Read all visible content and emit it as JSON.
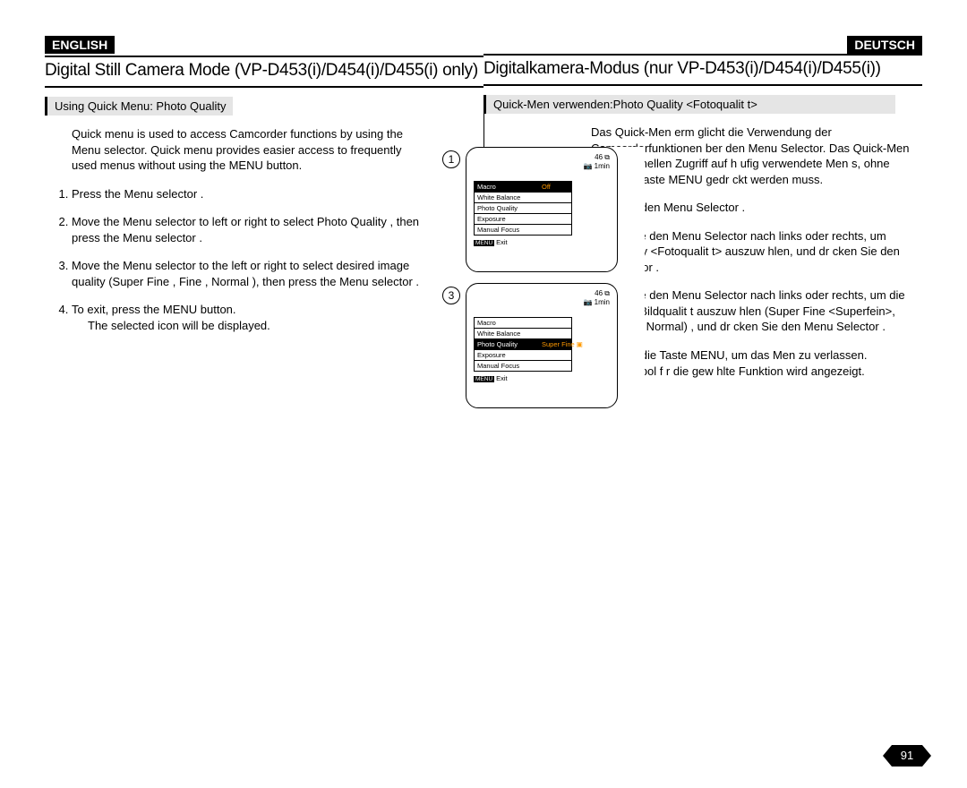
{
  "left": {
    "lang": "ENGLISH",
    "title": "Digital Still Camera Mode (VP-D453(i)/D454(i)/D455(i) only)",
    "subhead": "Using Quick Menu: Photo Quality",
    "intro": "Quick menu is used to access Camcorder functions by using the Menu selector. Quick menu provides easier access to frequently used menus without using the MENU button.",
    "steps": [
      "Press the Menu selector .",
      "Move the Menu selector  to left or right to select Photo Quality , then press the Menu selector .",
      "Move the Menu selector  to the left or right to select desired image quality (Super Fine , Fine , Normal ), then press the Menu selector .",
      "To exit, press the MENU button."
    ],
    "step4_note": "The selected icon will be displayed."
  },
  "right": {
    "lang": "DEUTSCH",
    "title": "Digitalkamera-Modus (nur VP-D453(i)/D454(i)/D455(i))",
    "subhead": "Quick-Men  verwenden:Photo Quality <Fotoqualit t>",
    "intro": "Das Quick-Men  erm glicht die Verwendung der Camcorderfunktionen  ber den Menu Selector. Das Quick-Men  bietet schnellen Zugriff auf h ufig verwendete Men s, ohne dass die Taste MENU gedr ckt werden muss.",
    "steps": [
      "Dr cken Sie den Menu Selector .",
      "Bewegen Sie den Menu Selector  nach links oder rechts, um Photo Quality <Fotoqualit t> auszuw hlen, und dr cken Sie den Menu Selector .",
      "Bewegen Sie den Menu Selector  nach links oder rechts, um die gew nschte Bildqualit t auszuw hlen (Super Fine <Superfein>, Fine <Fein>, Normal) , und dr cken Sie den Menu Selector .",
      "Dr cken Sie die Taste MENU, um das Men  zu verlassen."
    ],
    "step4_note": "Das Symbol f r die gew hlte Funktion wird angezeigt."
  },
  "menu_items": [
    "Macro",
    "White Balance",
    "Photo Quality",
    "Exposure",
    "Manual Focus"
  ],
  "screen": {
    "shots": "46",
    "time": "1min",
    "exit": "Exit",
    "menu_label": "MENU",
    "off": "Off",
    "superfine": "Super Fine"
  },
  "fig_labels": {
    "one": "1",
    "three": "3"
  },
  "page_number": "91"
}
